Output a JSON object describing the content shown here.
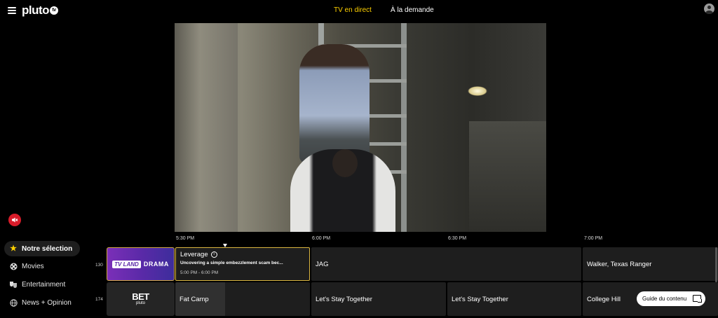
{
  "header": {
    "logo": "pluto",
    "logo_badge": "tv",
    "tabs": [
      {
        "label": "TV en direct",
        "active": true
      },
      {
        "label": "À la demande",
        "active": false
      }
    ]
  },
  "colors": {
    "accent": "#ffd100",
    "mute_button": "#d81c2a",
    "selection_border": "#d9b43f"
  },
  "sidebar": {
    "items": [
      {
        "label": "Notre sélection",
        "icon": "star-icon",
        "active": true
      },
      {
        "label": "Movies",
        "icon": "film-reel-icon",
        "active": false
      },
      {
        "label": "Entertainment",
        "icon": "theater-masks-icon",
        "active": false
      },
      {
        "label": "News + Opinion",
        "icon": "globe-icon",
        "active": false
      }
    ]
  },
  "timeline": {
    "times": [
      "5:30 PM",
      "6:00 PM",
      "6:30 PM",
      "7:00 PM"
    ]
  },
  "channels": [
    {
      "number": "130",
      "logo_badge": "TV LAND",
      "logo_text": "DRAMA",
      "programs": [
        {
          "title": "Leverage",
          "description": "Uncovering a simple embezzlement scam bec...",
          "time": "5:00 PM - 6:00 PM",
          "current": true
        },
        {
          "title": "JAG"
        },
        {
          "title": "Walker, Texas Ranger"
        }
      ]
    },
    {
      "number": "174",
      "logo_text": "BET",
      "logo_sub": "pluto",
      "programs": [
        {
          "title": "Fat Camp"
        },
        {
          "title": "Let's Stay Together"
        },
        {
          "title": "Let's Stay Together"
        },
        {
          "title": "College Hill"
        }
      ]
    }
  ],
  "guide_button": {
    "label": "Guide du contenu"
  }
}
